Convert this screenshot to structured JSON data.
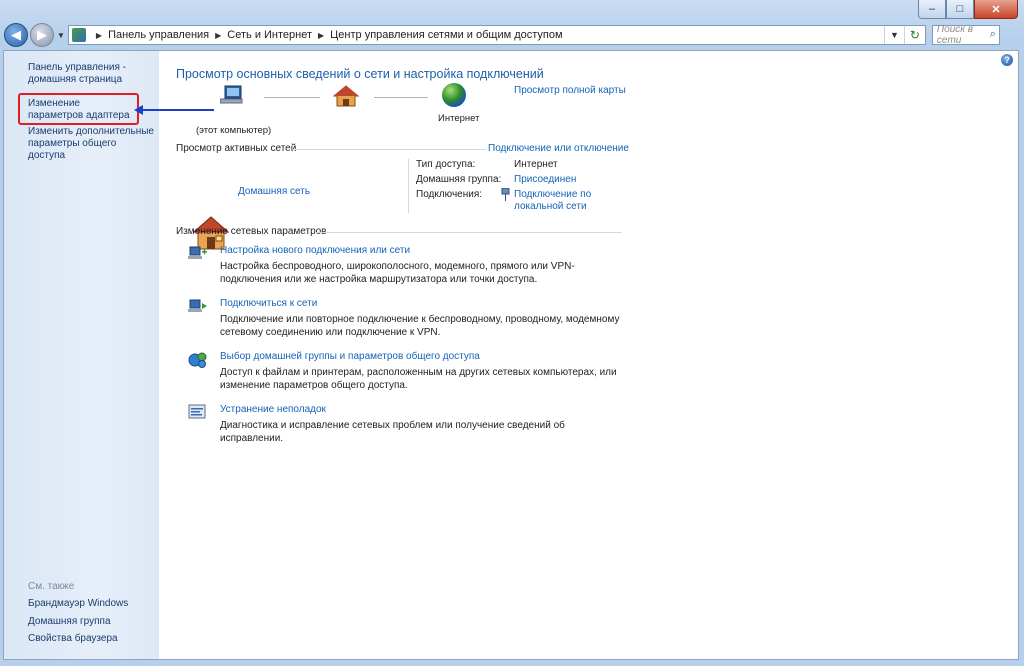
{
  "window": {
    "caption": {
      "minimize": "–",
      "maximize": "□",
      "close": "✕"
    }
  },
  "toolbar": {
    "breadcrumb": [
      "Панель управления",
      "Сеть и Интернет",
      "Центр управления сетями и общим доступом"
    ],
    "search_placeholder": "Поиск в сети"
  },
  "sidebar": {
    "home_link": "Панель управления - домашняя страница",
    "adapter_link": "Изменение параметров адаптера",
    "sharing_link": "Изменить дополнительные параметры общего доступа",
    "see_also": "См. также",
    "see_also_items": [
      "Брандмауэр Windows",
      "Домашняя группа",
      "Свойства браузера"
    ]
  },
  "main": {
    "title": "Просмотр основных сведений о сети и настройка подключений",
    "full_map_link": "Просмотр полной карты",
    "map": {
      "computer_label": "(этот компьютер)",
      "internet_label": "Интернет"
    },
    "active_networks": {
      "heading": "Просмотр активных сетей",
      "connect_disconnect": "Подключение или отключение",
      "network_name": "Домашняя сеть",
      "access_type_label": "Тип доступа:",
      "access_type_value": "Интернет",
      "homegroup_label": "Домашняя группа:",
      "homegroup_value": "Присоединен",
      "connections_label": "Подключения:",
      "connection_value_1": "Подключение по",
      "connection_value_2": "локальной сети"
    },
    "change_settings": {
      "heading": "Изменение сетевых параметров",
      "tasks": [
        {
          "link": "Настройка нового подключения или сети",
          "desc": "Настройка беспроводного, широкополосного, модемного, прямого или VPN-подключения или же настройка маршрутизатора или точки доступа."
        },
        {
          "link": "Подключиться к сети",
          "desc": "Подключение или повторное подключение к беспроводному, проводному, модемному сетевому соединению или подключение к VPN."
        },
        {
          "link": "Выбор домашней группы и параметров общего доступа",
          "desc": "Доступ к файлам и принтерам, расположенным на других сетевых компьютерах, или изменение параметров общего доступа."
        },
        {
          "link": "Устранение неполадок",
          "desc": "Диагностика и исправление сетевых проблем или получение сведений об исправлении."
        }
      ]
    }
  },
  "colors": {
    "link": "#1463b8",
    "title": "#1d5fa8",
    "highlight": "#e02020",
    "arrow": "#1b3fc7"
  }
}
